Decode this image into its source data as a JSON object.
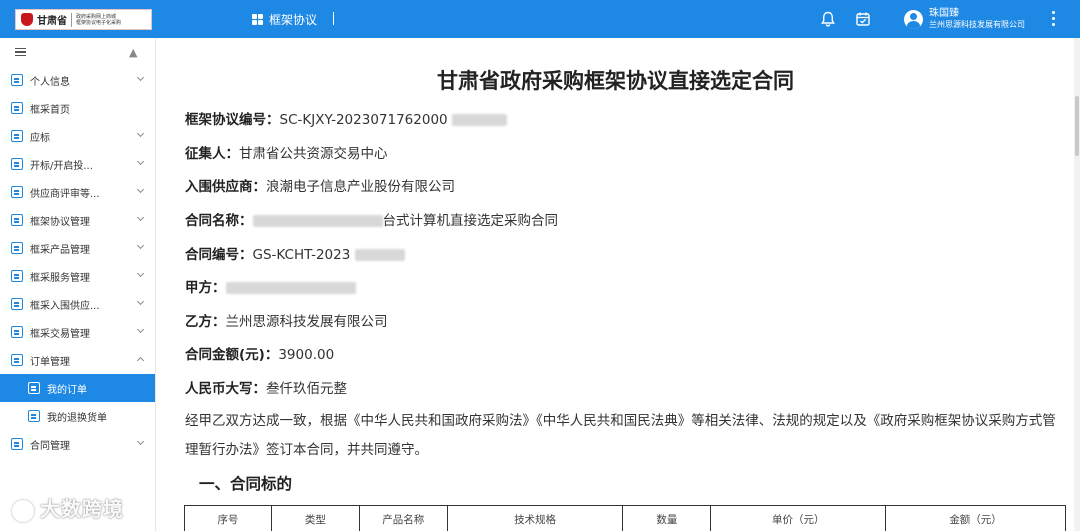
{
  "colors": {
    "primary": "#1e88e5",
    "emblem": "#c8161d"
  },
  "header": {
    "logo_name": "甘肃省",
    "logo_sub_line1": "政府采购网上商城",
    "logo_sub_line2": "框架协议电子化采购",
    "nav_label": "框架协议",
    "nav_icon": "grid-icon",
    "user_name": "珠国臻",
    "user_org": "兰州思源科技发展有限公司",
    "icons": [
      "bell-icon",
      "inbox-icon",
      "avatar",
      "more-icon"
    ]
  },
  "sidebar": {
    "items": [
      {
        "label": "个人信息",
        "icon": "user-card-icon",
        "expandable": true
      },
      {
        "label": "框采首页",
        "icon": "home-doc-icon",
        "expandable": false
      },
      {
        "label": "应标",
        "icon": "bid-icon",
        "expandable": true
      },
      {
        "label": "开标/开启投...",
        "icon": "open-bid-icon",
        "expandable": true
      },
      {
        "label": "供应商评审等...",
        "icon": "review-icon",
        "expandable": true
      },
      {
        "label": "框架协议管理",
        "icon": "agreement-icon",
        "expandable": true
      },
      {
        "label": "框采产品管理",
        "icon": "product-icon",
        "expandable": true
      },
      {
        "label": "框采服务管理",
        "icon": "service-icon",
        "expandable": true
      },
      {
        "label": "框采入围供应...",
        "icon": "supplier-icon",
        "expandable": true
      },
      {
        "label": "框采交易管理",
        "icon": "trade-icon",
        "expandable": true
      },
      {
        "label": "订单管理",
        "icon": "order-icon",
        "expandable": true,
        "expanded": true
      },
      {
        "label": "我的订单",
        "icon": "my-order-icon",
        "sub": true,
        "active": true
      },
      {
        "label": "我的退换货单",
        "icon": "return-icon",
        "sub": true
      },
      {
        "label": "合同管理",
        "icon": "contract-icon",
        "expandable": true
      }
    ]
  },
  "document": {
    "title": "甘肃省政府采购框架协议直接选定合同",
    "fields": [
      {
        "label": "框架协议编号：",
        "value": "SC-KJXY-2023071762000"
      },
      {
        "label": "征集人：",
        "value": "甘肃省公共资源交易中心"
      },
      {
        "label": "入围供应商：",
        "value": "浪潮电子信息产业股份有限公司"
      },
      {
        "label": "合同名称：",
        "value": "台式计算机直接选定采购合同"
      },
      {
        "label": "合同编号：",
        "value": "GS-KCHT-2023"
      },
      {
        "label": "甲方：",
        "value": ""
      },
      {
        "label": "乙方：",
        "value": "兰州思源科技发展有限公司"
      },
      {
        "label": "合同金额(元)：",
        "value": "3900.00"
      },
      {
        "label": "人民币大写：",
        "value": "叁仟玖佰元整"
      }
    ],
    "paragraph": "经甲乙双方达成一致，根据《中华人民共和国政府采购法》《中华人民共和国民法典》等相关法律、法规的规定以及《政府采购框架协议采购方式管理暂行办法》签订本合同，并共同遵守。",
    "section_title": "一、合同标的",
    "table_headers": [
      "序号",
      "类型",
      "产品名称",
      "技术规格",
      "数量",
      "单价（元）",
      "金额（元）"
    ]
  },
  "watermark": "大数跨境"
}
